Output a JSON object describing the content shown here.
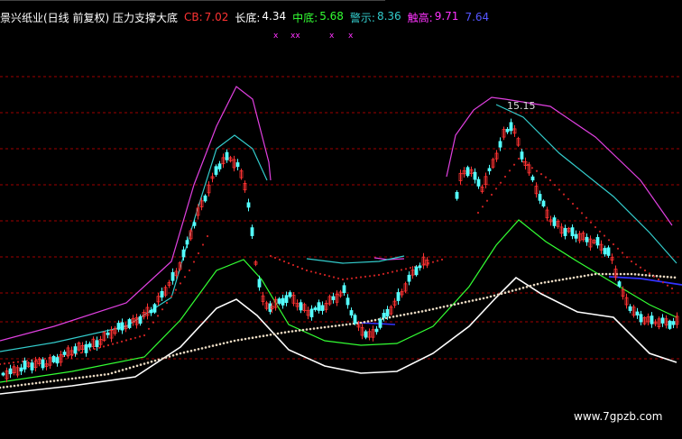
{
  "header": {
    "title": "景兴纸业(日线 前复权) 压力支撑大底",
    "items": [
      {
        "label": "CB:",
        "value": "7.02",
        "color": "#ff3333"
      },
      {
        "label": "长底:",
        "value": "4.34",
        "color": "#ffffff"
      },
      {
        "label": "中底:",
        "value": "5.68",
        "color": "#33ff33"
      },
      {
        "label": "警示:",
        "value": "8.36",
        "color": "#33cccc"
      },
      {
        "label": "触高:",
        "value": "9.71",
        "color": "#ff33ff"
      },
      {
        "label": "",
        "value": "7.64",
        "color": "#3333ff"
      }
    ]
  },
  "watermark": "www.7gpzb.com",
  "chart_data": {
    "type": "line",
    "annotation": "15.15",
    "grid": true,
    "colors": {
      "up": "#ff3333",
      "down": "#54ffff",
      "grid": "#a00000",
      "upper_band": "#e040e0",
      "warn_band": "#33cccc",
      "mid_band": "#33ff33",
      "lower_band": "#ffffff",
      "dotted_dark": "#cc2222",
      "dotted_light": "#e8d8c0",
      "blue_line": "#3333ff"
    }
  }
}
